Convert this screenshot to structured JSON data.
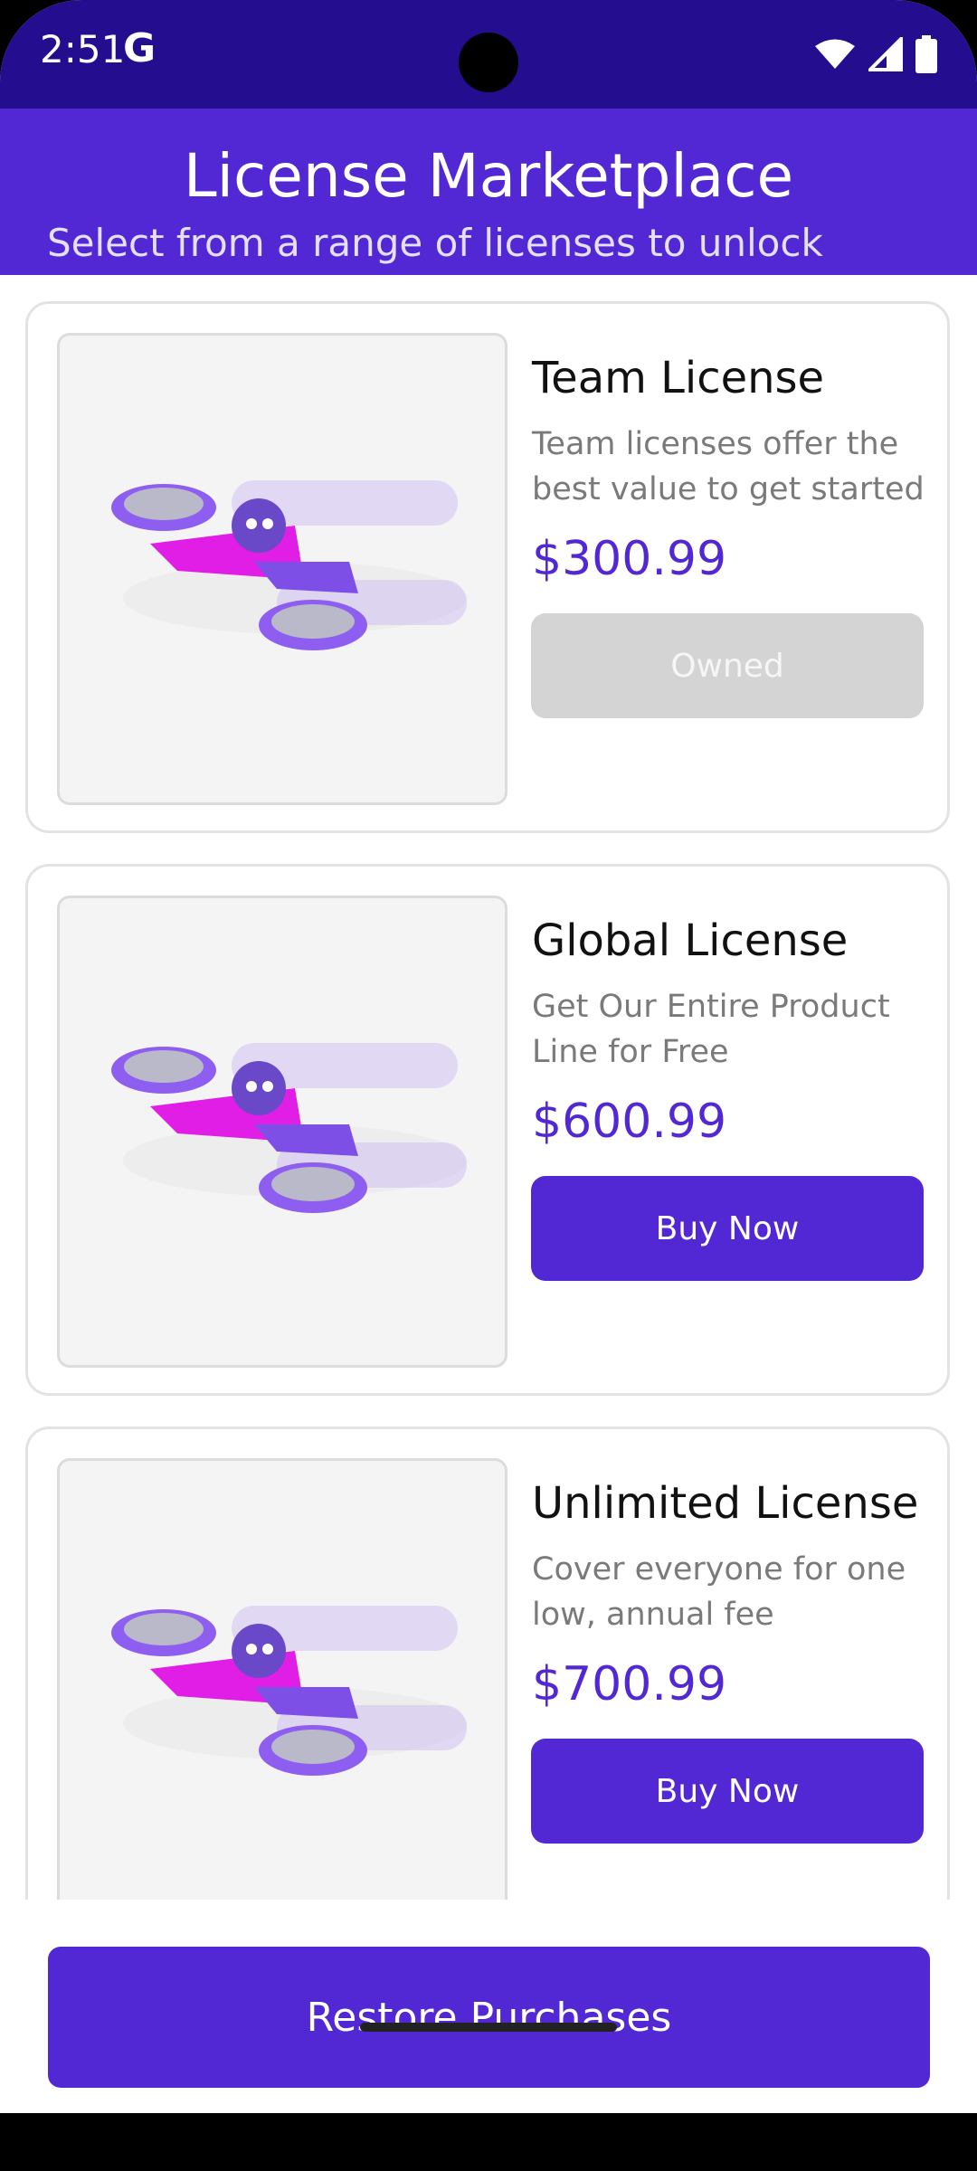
{
  "status_bar": {
    "time": "2:51",
    "g_logo": "G",
    "icons": [
      "wifi-icon",
      "cellular-signal-icon",
      "battery-icon"
    ]
  },
  "header": {
    "title": "License Marketplace",
    "subtitle": "Select from a range of licenses to unlock"
  },
  "licenses": [
    {
      "title": "Team License",
      "description": "Team licenses offer the best value to get started",
      "price": "$300.99",
      "button_label": "Owned",
      "owned": true
    },
    {
      "title": "Global License",
      "description": "Get Our Entire Product Line for Free",
      "price": "$600.99",
      "button_label": "Buy Now",
      "owned": false
    },
    {
      "title": "Unlimited License",
      "description": "Cover everyone for one low, annual fee",
      "price": "$700.99",
      "button_label": "Buy Now",
      "owned": false
    }
  ],
  "footer": {
    "restore_label": "Restore Purchases"
  },
  "colors": {
    "status_bar": "#240e8f",
    "accent": "#5128d4",
    "owned_button": "#d4d4d4"
  }
}
